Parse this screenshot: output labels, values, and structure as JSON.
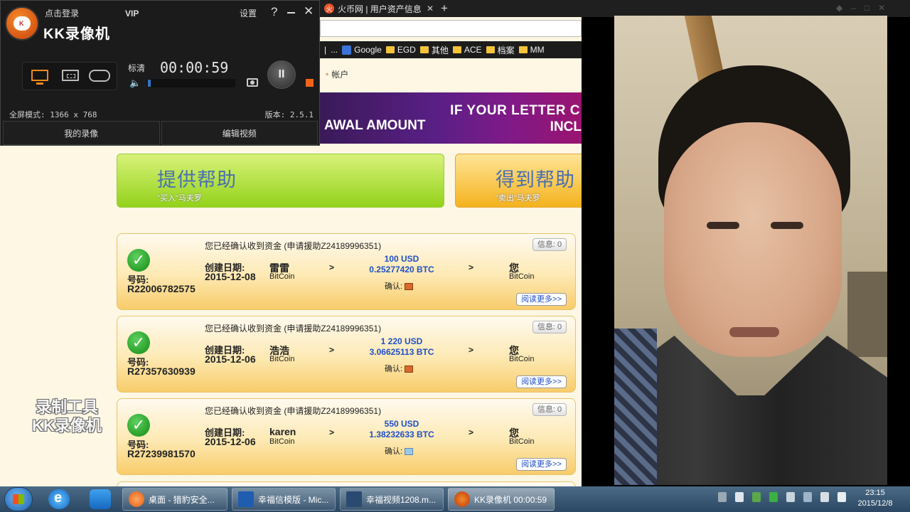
{
  "browser": {
    "tab_title": "火币网 | 用户资产信息",
    "tab_favicon": "huobi-icon",
    "new_tab_label": "+",
    "bookmarks": [
      "|",
      "...",
      "Google",
      "EGD",
      "其他",
      "ACE",
      "档案",
      "MM"
    ],
    "account_label": "帐户",
    "banner": {
      "line1": "IF YOUR LETTER C",
      "line2": "AWAL AMOUNT",
      "line3": "INCL"
    }
  },
  "actions": {
    "provide_title": "提供帮助",
    "provide_sub": "\"买入\"马夫罗",
    "receive_title": "得到帮助",
    "receive_sub": "\"卖出\"马夫罗"
  },
  "orders": [
    {
      "heading": "您已经确认收到资金 (申请援助Z24189996351)",
      "number_label": "号码:",
      "number": "R22006782575",
      "date_label": "创建日期:",
      "date": "2015-12-08",
      "sender": "雷雷",
      "sender_currency": "BitCoin",
      "usd": "100 USD",
      "btc": "0.25277420 BTC",
      "confirm_label": "确认:",
      "receiver": "您",
      "receiver_currency": "BitCoin",
      "info_label": "信息: 0",
      "more_label": "阅读更多>>"
    },
    {
      "heading": "您已经确认收到资金 (申请援助Z24189996351)",
      "number_label": "号码:",
      "number": "R27357630939",
      "date_label": "创建日期:",
      "date": "2015-12-06",
      "sender": "浩浩",
      "sender_currency": "BitCoin",
      "usd": "1 220 USD",
      "btc": "3.06625113 BTC",
      "confirm_label": "确认:",
      "receiver": "您",
      "receiver_currency": "BitCoin",
      "info_label": "信息: 0",
      "more_label": "阅读更多>>"
    },
    {
      "heading": "您已经确认收到资金 (申请援助Z24189996351)",
      "number_label": "号码:",
      "number": "R27239981570",
      "date_label": "创建日期:",
      "date": "2015-12-06",
      "sender": "karen",
      "sender_currency": "BitCoin",
      "usd": "550 USD",
      "btc": "1.38232633 BTC",
      "confirm_label": "确认:",
      "receiver": "您",
      "receiver_currency": "BitCoin",
      "info_label": "信息: 0",
      "more_label": "阅读更多>>"
    }
  ],
  "arrow": ">",
  "recorder": {
    "login": "点击登录",
    "vip": "VIP",
    "title": "KK录像机",
    "settings": "设置",
    "help": "?",
    "close": "✕",
    "quality": "标清",
    "timer": "00:00:59",
    "pause": "II",
    "mode_text": "全屏模式: 1366 x 768",
    "version": "版本: 2.5.1",
    "my_recordings": "我的录像",
    "edit_video": "编辑视频",
    "volume_level": 0.03
  },
  "watermark": {
    "line1": "录制工具",
    "line2": "KK录像机"
  },
  "taskbar": {
    "tasks": [
      "桌面 - 猎豹安全...",
      "幸福信模版 - Mic...",
      "幸福视频1208.m...",
      "KK录像机 00:00:59"
    ],
    "time": "23:15",
    "date": "2015/12/8"
  }
}
